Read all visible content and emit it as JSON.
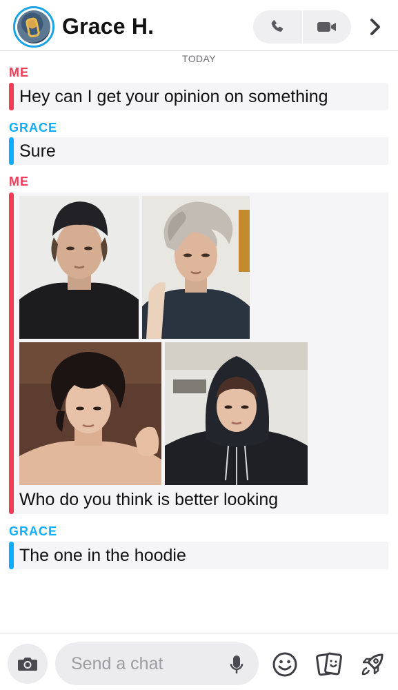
{
  "header": {
    "title": "Grace H.",
    "icons": {
      "avatar": "bitmoji-avatar",
      "call": "phone-icon",
      "video": "video-camera-icon",
      "more": "chevron-right-icon"
    }
  },
  "chat": {
    "date_divider": "TODAY",
    "messages": [
      {
        "sender": "ME",
        "text": "Hey can I get your opinion on something"
      },
      {
        "sender": "GRACE",
        "text": "Sure"
      },
      {
        "sender": "ME",
        "text": "Who do you think is better looking",
        "attachments": [
          "photo",
          "photo",
          "photo",
          "photo"
        ]
      },
      {
        "sender": "GRACE",
        "text": "The one in the hoodie"
      }
    ]
  },
  "footer": {
    "input_placeholder": "Send a chat",
    "icons": [
      "camera-icon",
      "microphone-icon",
      "smiley-icon",
      "sticker-cards-icon",
      "rocket-icon"
    ]
  },
  "colors": {
    "me": "#f23c57",
    "grace": "#0eadff",
    "bubble": "#f5f5f7"
  }
}
